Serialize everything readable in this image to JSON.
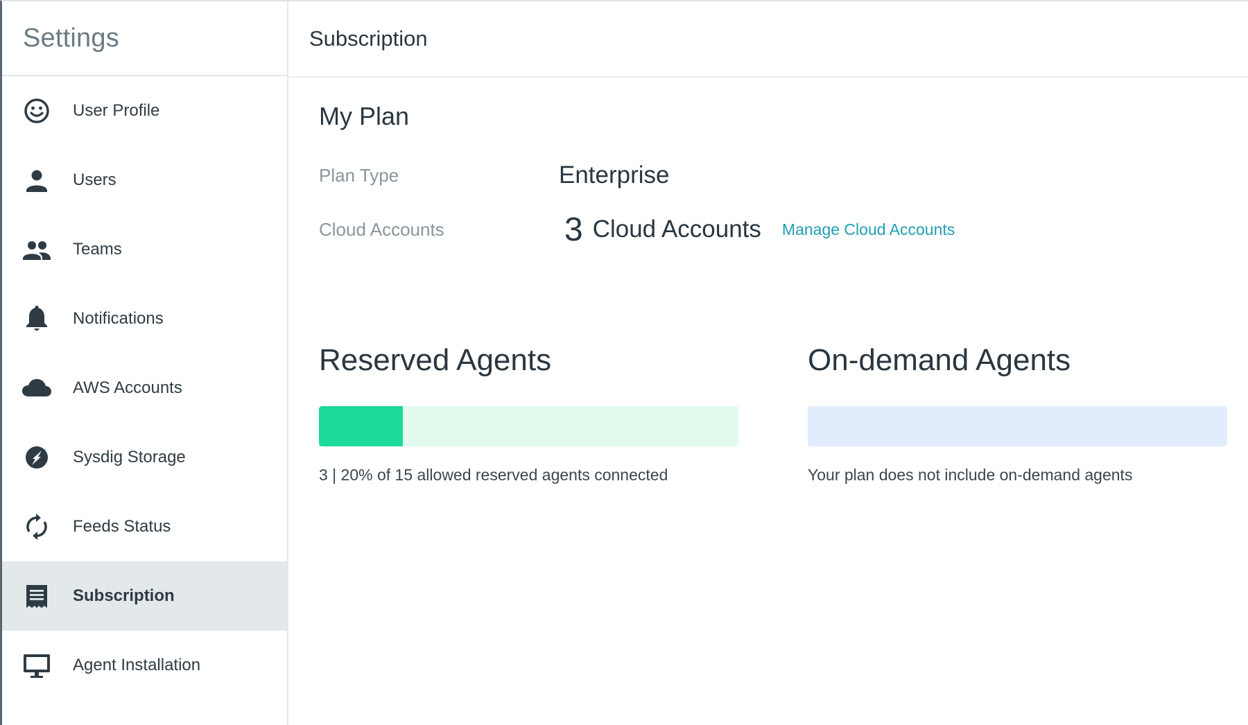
{
  "sidebar": {
    "title": "Settings",
    "items": [
      {
        "label": "User Profile",
        "icon": "smiley-face-icon"
      },
      {
        "label": "Users",
        "icon": "person-icon"
      },
      {
        "label": "Teams",
        "icon": "people-icon"
      },
      {
        "label": "Notifications",
        "icon": "bell-icon"
      },
      {
        "label": "AWS Accounts",
        "icon": "cloud-icon"
      },
      {
        "label": "Sysdig Storage",
        "icon": "storage-icon"
      },
      {
        "label": "Feeds Status",
        "icon": "refresh-icon"
      },
      {
        "label": "Subscription",
        "icon": "receipt-icon",
        "active": true
      },
      {
        "label": "Agent Installation",
        "icon": "monitor-icon"
      }
    ]
  },
  "header": {
    "title": "Subscription"
  },
  "plan": {
    "section_title": "My Plan",
    "plan_type_label": "Plan Type",
    "plan_type_value": "Enterprise",
    "cloud_accounts_label": "Cloud Accounts",
    "cloud_accounts_count": "3",
    "cloud_accounts_unit": "Cloud Accounts",
    "manage_link": "Manage Cloud Accounts"
  },
  "reserved_agents": {
    "title": "Reserved Agents",
    "fill_fraction": 0.2,
    "caption": "3 | 20% of 15 allowed reserved agents connected"
  },
  "on_demand_agents": {
    "title": "On-demand Agents",
    "fill_fraction": 0,
    "caption": "Your plan does not include on-demand agents"
  },
  "colors": {
    "reserved_fill": "#1dd99a",
    "reserved_track": "#e1faee",
    "on_demand_track": "#e1edfd",
    "link": "#1f9fb0",
    "active_nav_bg": "#e3e9ea"
  }
}
